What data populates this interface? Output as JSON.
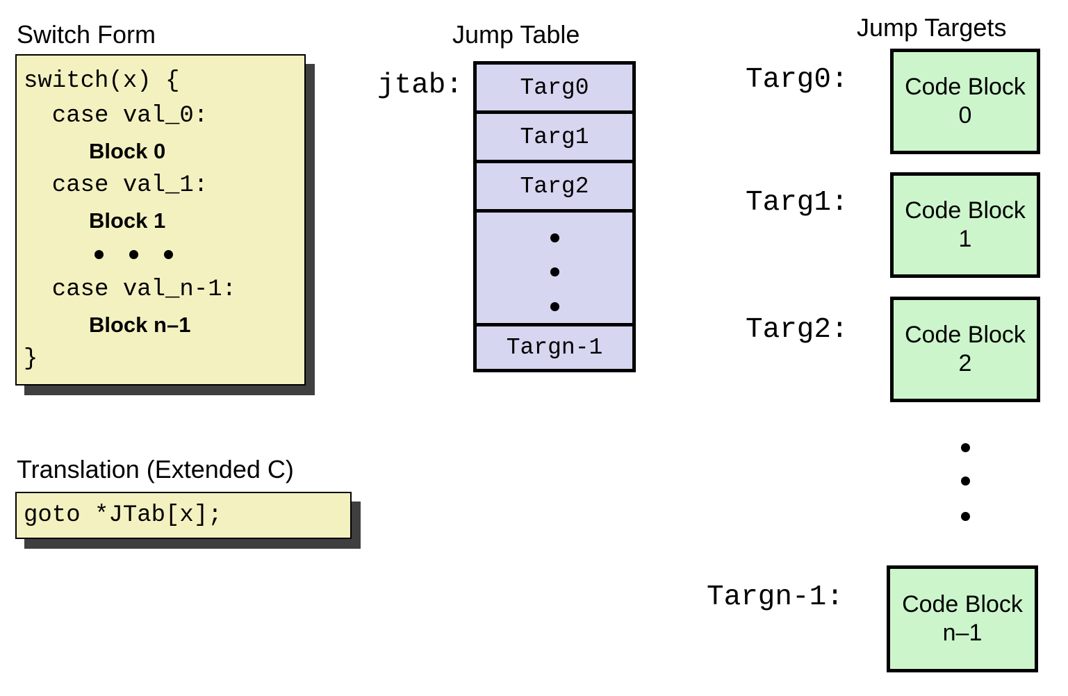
{
  "sections": {
    "switch_form": {
      "title": "Switch Form",
      "code_lines": [
        "switch(x) {",
        "  case val_0:",
        "  case val_1:",
        "  case val_n-1:",
        "}"
      ],
      "block_lines": [
        "Block 0",
        "Block 1",
        "Block n–1"
      ],
      "ellipsis_dots": 3
    },
    "translation": {
      "title": "Translation (Extended C)",
      "code": "goto *JTab[x];"
    },
    "jump_table": {
      "title": "Jump Table",
      "pointer_label": "jtab:",
      "entries": [
        "Targ0",
        "Targ1",
        "Targ2",
        "Targn-1"
      ],
      "ellipsis_dots": 3
    },
    "jump_targets": {
      "title": "Jump Targets",
      "targets": [
        {
          "label": "Targ0:",
          "block_line1": "Code Block",
          "block_line2": "0"
        },
        {
          "label": "Targ1:",
          "block_line1": "Code Block",
          "block_line2": "1"
        },
        {
          "label": "Targ2:",
          "block_line1": "Code Block",
          "block_line2": "2"
        },
        {
          "label": "Targn-1:",
          "block_line1": "Code Block",
          "block_line2": "n–1"
        }
      ],
      "ellipsis_dots": 3
    }
  },
  "colors": {
    "background": "#ffffff",
    "code_box_fill": "#f4f1c1",
    "code_box_shadow": "#3f3f3f",
    "jump_table_fill": "#d6d6f0",
    "code_block_fill": "#ccf5cc",
    "border": "#000000",
    "text": "#000000"
  }
}
